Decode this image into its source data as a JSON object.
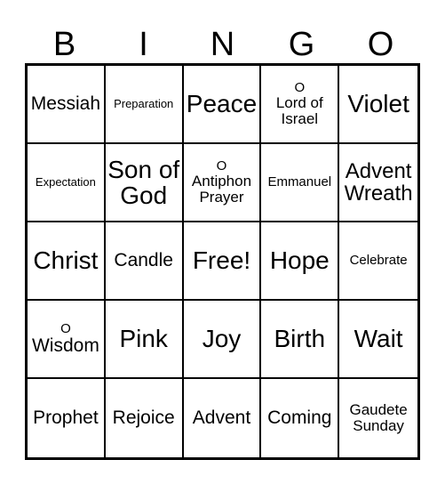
{
  "card": {
    "title_letters": [
      "B",
      "I",
      "N",
      "G",
      "O"
    ],
    "accent_color": "#000000",
    "background_color": "#ffffff",
    "grid_size": "5x5"
  },
  "grid": {
    "rows": [
      {
        "cells": [
          {
            "text": "Messiah",
            "prefix": "",
            "size": "fs-l"
          },
          {
            "text": "Preparation",
            "prefix": "",
            "size": "fs-xs"
          },
          {
            "text": "Peace",
            "prefix": "",
            "size": "fs-xxl"
          },
          {
            "text": "Lord of Israel",
            "prefix": "O",
            "size": "fs-m"
          },
          {
            "text": "Violet",
            "prefix": "",
            "size": "fs-xxl"
          }
        ]
      },
      {
        "cells": [
          {
            "text": "Expectation",
            "prefix": "",
            "size": "fs-xs"
          },
          {
            "text": "Son of God",
            "prefix": "",
            "size": "fs-xxl"
          },
          {
            "text": "Antiphon Prayer",
            "prefix": "O",
            "size": "fs-m"
          },
          {
            "text": "Emmanuel",
            "prefix": "",
            "size": "fs-s"
          },
          {
            "text": "Advent Wreath",
            "prefix": "",
            "size": "fs-xl"
          }
        ]
      },
      {
        "cells": [
          {
            "text": "Christ",
            "prefix": "",
            "size": "fs-xxl"
          },
          {
            "text": "Candle",
            "prefix": "",
            "size": "fs-l"
          },
          {
            "text": "Free!",
            "prefix": "",
            "size": "fs-xxl"
          },
          {
            "text": "Hope",
            "prefix": "",
            "size": "fs-xxl"
          },
          {
            "text": "Celebrate",
            "prefix": "",
            "size": "fs-s"
          }
        ]
      },
      {
        "cells": [
          {
            "text": "Wisdom",
            "prefix": "O",
            "size": "fs-l"
          },
          {
            "text": "Pink",
            "prefix": "",
            "size": "fs-xxl"
          },
          {
            "text": "Joy",
            "prefix": "",
            "size": "fs-xxl"
          },
          {
            "text": "Birth",
            "prefix": "",
            "size": "fs-xxl"
          },
          {
            "text": "Wait",
            "prefix": "",
            "size": "fs-xxl"
          }
        ]
      },
      {
        "cells": [
          {
            "text": "Prophet",
            "prefix": "",
            "size": "fs-l"
          },
          {
            "text": "Rejoice",
            "prefix": "",
            "size": "fs-l"
          },
          {
            "text": "Advent",
            "prefix": "",
            "size": "fs-l"
          },
          {
            "text": "Coming",
            "prefix": "",
            "size": "fs-l"
          },
          {
            "text": "Gaudete Sunday",
            "prefix": "",
            "size": "fs-m"
          }
        ]
      }
    ]
  }
}
